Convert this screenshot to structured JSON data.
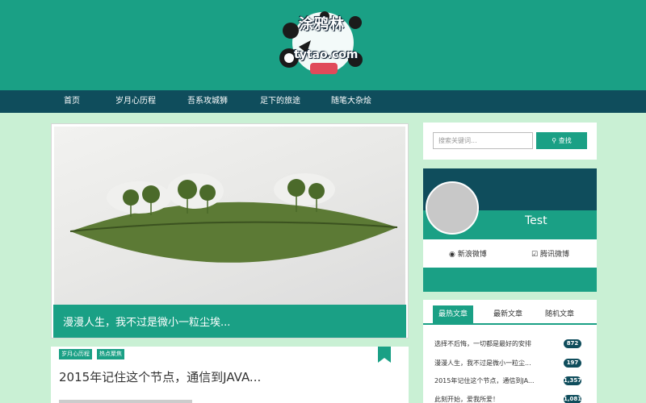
{
  "site": {
    "logo_line1": "涂鸦林",
    "logo_line2": "tytao.com"
  },
  "nav": {
    "items": [
      {
        "label": "首页"
      },
      {
        "label": "岁月心历程"
      },
      {
        "label": "吾系攻城狮"
      },
      {
        "label": "足下的旅途"
      },
      {
        "label": "随笔大杂烩"
      }
    ]
  },
  "featured": {
    "caption": "漫漫人生，我不过是微小一粒尘埃..."
  },
  "post": {
    "tags": [
      "岁月心历程",
      "热点聚焦"
    ],
    "title": "2015年记住这个节点，通信到JAVA..."
  },
  "search": {
    "placeholder": "搜索关键词...",
    "button_label": "查找"
  },
  "profile": {
    "name": "Test",
    "weibo_label": "新浪微博",
    "tencent_label": "腾讯微博"
  },
  "articles_widget": {
    "tabs": [
      {
        "label": "最热文章",
        "active": true
      },
      {
        "label": "最新文章",
        "active": false
      },
      {
        "label": "随机文章",
        "active": false
      }
    ],
    "items": [
      {
        "title": "选择不后悔，一切都是最好的安排",
        "count": "872"
      },
      {
        "title": "漫漫人生，我不过是微小一粒尘...",
        "count": "197"
      },
      {
        "title": "2015年记住这个节点，通信到JA...",
        "count": "1,357"
      },
      {
        "title": "此刻开始，爱我所爱！",
        "count": "1,081"
      }
    ]
  },
  "colors": {
    "brand_green": "#1aa085",
    "dark_teal": "#0f4d5c",
    "page_bg": "#c9f0d4"
  }
}
